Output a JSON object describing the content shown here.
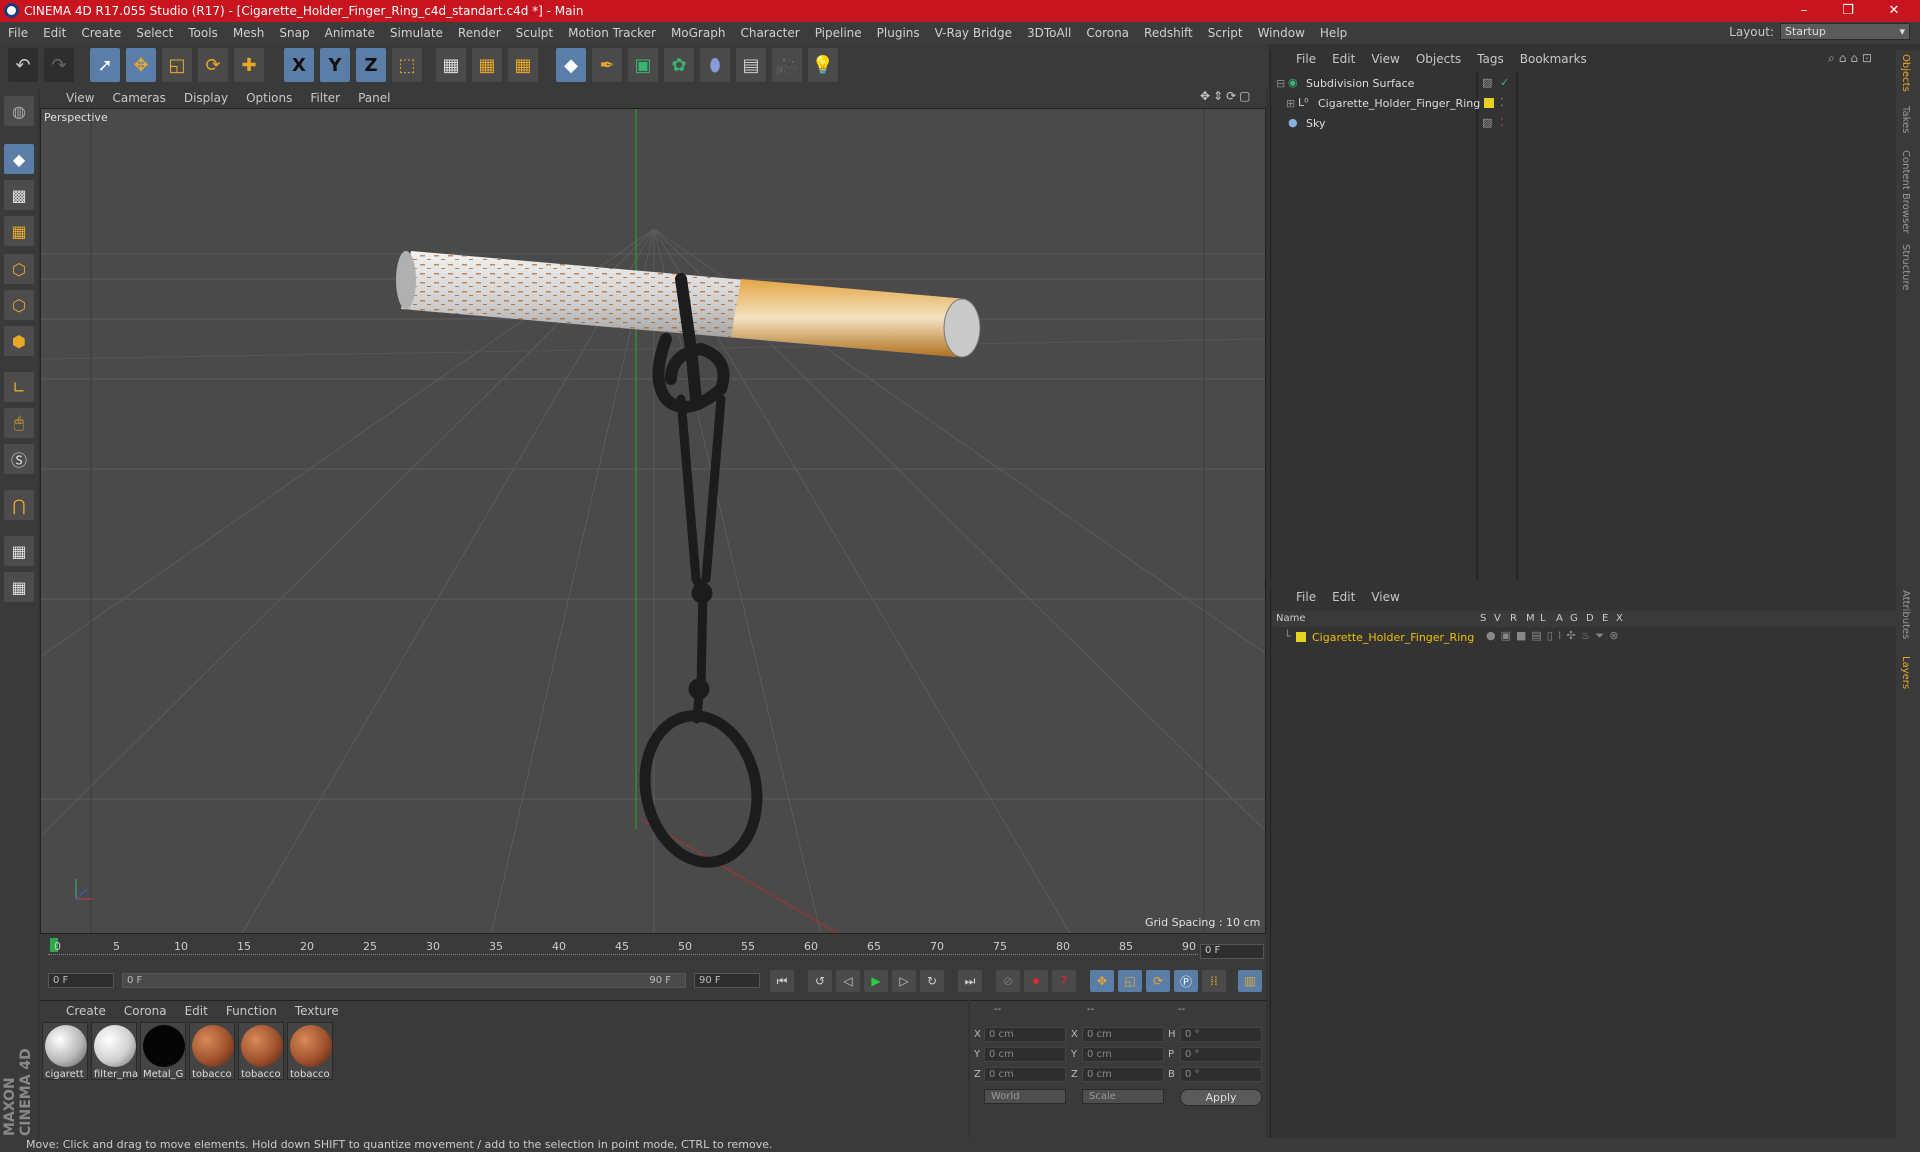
{
  "window": {
    "title": "CINEMA 4D R17.055 Studio (R17) - [Cigarette_Holder_Finger_Ring_c4d_standart.c4d *] - Main",
    "minimize": "–",
    "maximize": "❐",
    "close": "✕"
  },
  "menu": [
    "File",
    "Edit",
    "Create",
    "Select",
    "Tools",
    "Mesh",
    "Snap",
    "Animate",
    "Simulate",
    "Render",
    "Sculpt",
    "Motion Tracker",
    "MoGraph",
    "Character",
    "Pipeline",
    "Plugins",
    "V-Ray Bridge",
    "3DToAll",
    "Corona",
    "Redshift",
    "Script",
    "Window",
    "Help"
  ],
  "layout": {
    "label": "Layout:",
    "value": "Startup"
  },
  "toolbar": {
    "x": "X",
    "y": "Y",
    "z": "Z"
  },
  "viewport": {
    "menu": [
      "View",
      "Cameras",
      "Display",
      "Options",
      "Filter",
      "Panel"
    ],
    "label": "Perspective",
    "grid_spacing": "Grid Spacing : 10 cm"
  },
  "timeline": {
    "ticks": [
      "0",
      "5",
      "10",
      "15",
      "20",
      "25",
      "30",
      "35",
      "40",
      "45",
      "50",
      "55",
      "60",
      "65",
      "70",
      "75",
      "80",
      "85",
      "90"
    ],
    "current_frame": "0 F",
    "start_field": "0 F",
    "range_start": "0 F",
    "range_end": "90 F",
    "end_field": "90 F"
  },
  "materials": {
    "menu": [
      "Create",
      "Corona",
      "Edit",
      "Function",
      "Texture"
    ],
    "items": [
      {
        "label": "cigarett",
        "color": "#d8d8d8"
      },
      {
        "label": "filter_ma",
        "color": "#e4e4e4"
      },
      {
        "label": "Metal_G",
        "color": "#050505"
      },
      {
        "label": "tobacco",
        "color": "#a0522d"
      },
      {
        "label": "tobacco",
        "color": "#a0522d"
      },
      {
        "label": "tobacco",
        "color": "#a0522d"
      }
    ]
  },
  "coords": {
    "head": [
      "--",
      "--",
      "--"
    ],
    "rows": [
      {
        "a": "X",
        "av": "0 cm",
        "b": "X",
        "bv": "0 cm",
        "c": "H",
        "cv": "0 °"
      },
      {
        "a": "Y",
        "av": "0 cm",
        "b": "Y",
        "bv": "0 cm",
        "c": "P",
        "cv": "0 °"
      },
      {
        "a": "Z",
        "av": "0 cm",
        "b": "Z",
        "bv": "0 cm",
        "c": "B",
        "cv": "0 °"
      }
    ],
    "world": "World",
    "scale": "Scale",
    "apply": "Apply"
  },
  "objects": {
    "menu": [
      "File",
      "Edit",
      "View",
      "Objects",
      "Tags",
      "Bookmarks"
    ],
    "items": [
      {
        "name": "Subdivision Surface"
      },
      {
        "name": "Cigarette_Holder_Finger_Ring"
      },
      {
        "name": "Sky"
      }
    ]
  },
  "layers": {
    "menu": [
      "File",
      "Edit",
      "View"
    ],
    "columns": [
      "Name",
      "S",
      "V",
      "R",
      "M",
      "L",
      "A",
      "G",
      "D",
      "E",
      "X"
    ],
    "items": [
      {
        "name": "Cigarette_Holder_Finger_Ring"
      }
    ]
  },
  "side_tabs": [
    "Objects",
    "Takes",
    "Content Browser",
    "Structure",
    "Attributes",
    "Layers"
  ],
  "brand": "MAXON CINEMA 4D",
  "status": "Move: Click and drag to move elements. Hold down SHIFT to quantize movement / add to the selection in point mode, CTRL to remove.",
  "colors": {
    "accent": "#e8a82a",
    "titlebar": "#c8141e",
    "layer_name": "#f0c000"
  }
}
